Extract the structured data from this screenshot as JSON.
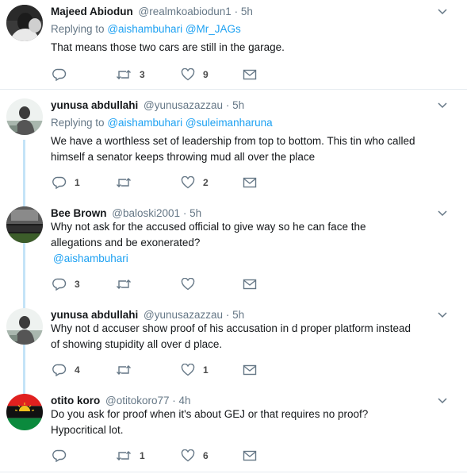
{
  "tweets": [
    {
      "name": "Majeed Abiodun",
      "handle": "@realmkoabiodun1",
      "time": "5h",
      "replying_prefix": "Replying to",
      "reply_to": [
        "@aishambuhari",
        "@Mr_JAGs"
      ],
      "text": [
        "That means those two cars are still in the garage."
      ],
      "replies": "",
      "retweets": "3",
      "likes": "9"
    },
    {
      "name": "yunusa abdullahi",
      "handle": "@yunusazazzau",
      "time": "5h",
      "replying_prefix": "Replying to",
      "reply_to": [
        "@aishambuhari",
        "@suleimanharuna"
      ],
      "text": [
        "We have a worthless set of leadership from top to bottom. This tin who called",
        "himself a senator keeps throwing mud all over the place"
      ],
      "replies": "1",
      "retweets": "",
      "likes": "2"
    },
    {
      "name": "Bee Brown",
      "handle": "@baloski2001",
      "time": "5h",
      "text": [
        "Why not ask for the accused official to give way so he can face the",
        "allegations and be exonerated?"
      ],
      "mention": "@aishambuhari",
      "replies": "3",
      "retweets": "",
      "likes": ""
    },
    {
      "name": "yunusa abdullahi",
      "handle": "@yunusazazzau",
      "time": "5h",
      "text": [
        "Why not d accuser show proof of his accusation in d proper platform instead",
        "of showing stupidity all over d place."
      ],
      "replies": "4",
      "retweets": "",
      "likes": "1"
    },
    {
      "name": "otito koro",
      "handle": "@otitokoro77",
      "time": "4h",
      "text": [
        "Do you ask for proof when it's about GEJ or that requires no proof?",
        "Hypocritical lot."
      ],
      "replies": "",
      "retweets": "1",
      "likes": "6"
    }
  ],
  "separator": "·",
  "icons": {
    "reply": "reply-icon",
    "retweet": "retweet-icon",
    "like": "heart-icon",
    "message": "envelope-icon",
    "more": "chevron-down-icon"
  },
  "colors": {
    "link": "#1da1f2",
    "secondary_text": "#657786",
    "thread_line": "#c4e3f7",
    "divider": "#e6ecf0"
  }
}
